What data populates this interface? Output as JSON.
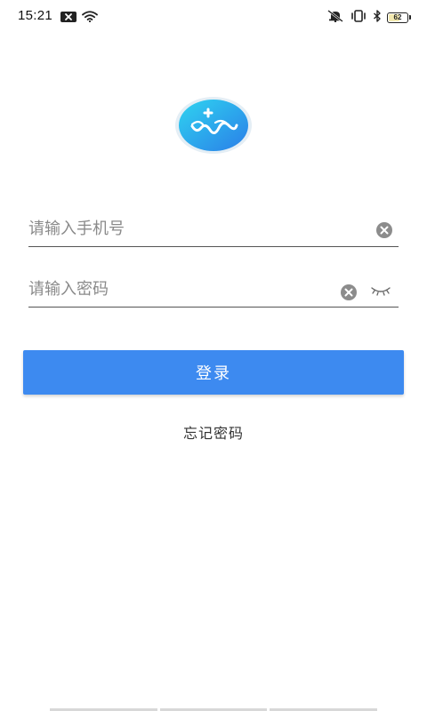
{
  "status_bar": {
    "time": "15:21",
    "battery_level": "62",
    "battery_fraction": 0.62,
    "left_icons": [
      "notification-x-icon",
      "wifi-icon"
    ],
    "right_icons": [
      "mute-icon",
      "vibrate-icon",
      "bluetooth-icon",
      "battery-icon"
    ]
  },
  "app": {
    "logo_icon": "app-logo-icon",
    "brand_color": "#3d8af0",
    "logo_gradient": [
      "#2fd4f0",
      "#2a7ee8"
    ]
  },
  "login_form": {
    "phone_placeholder": "请输入手机号",
    "phone_value": "",
    "password_placeholder": "请输入密码",
    "password_value": "",
    "submit_label": "登录",
    "forgot_password_label": "忘记密码"
  }
}
